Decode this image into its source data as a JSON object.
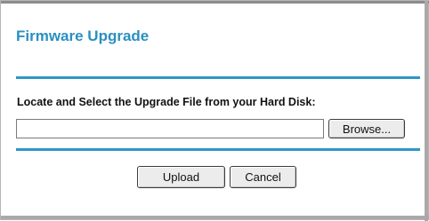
{
  "panel": {
    "title": "Firmware Upgrade",
    "locate_label": "Locate and Select the Upgrade File from your Hard Disk:",
    "file_input": {
      "value": "",
      "placeholder": ""
    },
    "browse_label": "Browse...",
    "upload_label": "Upload",
    "cancel_label": "Cancel"
  },
  "colors": {
    "title": "#2b8fc0",
    "rule": "#2b98c6",
    "button_bg": "#ececec"
  }
}
